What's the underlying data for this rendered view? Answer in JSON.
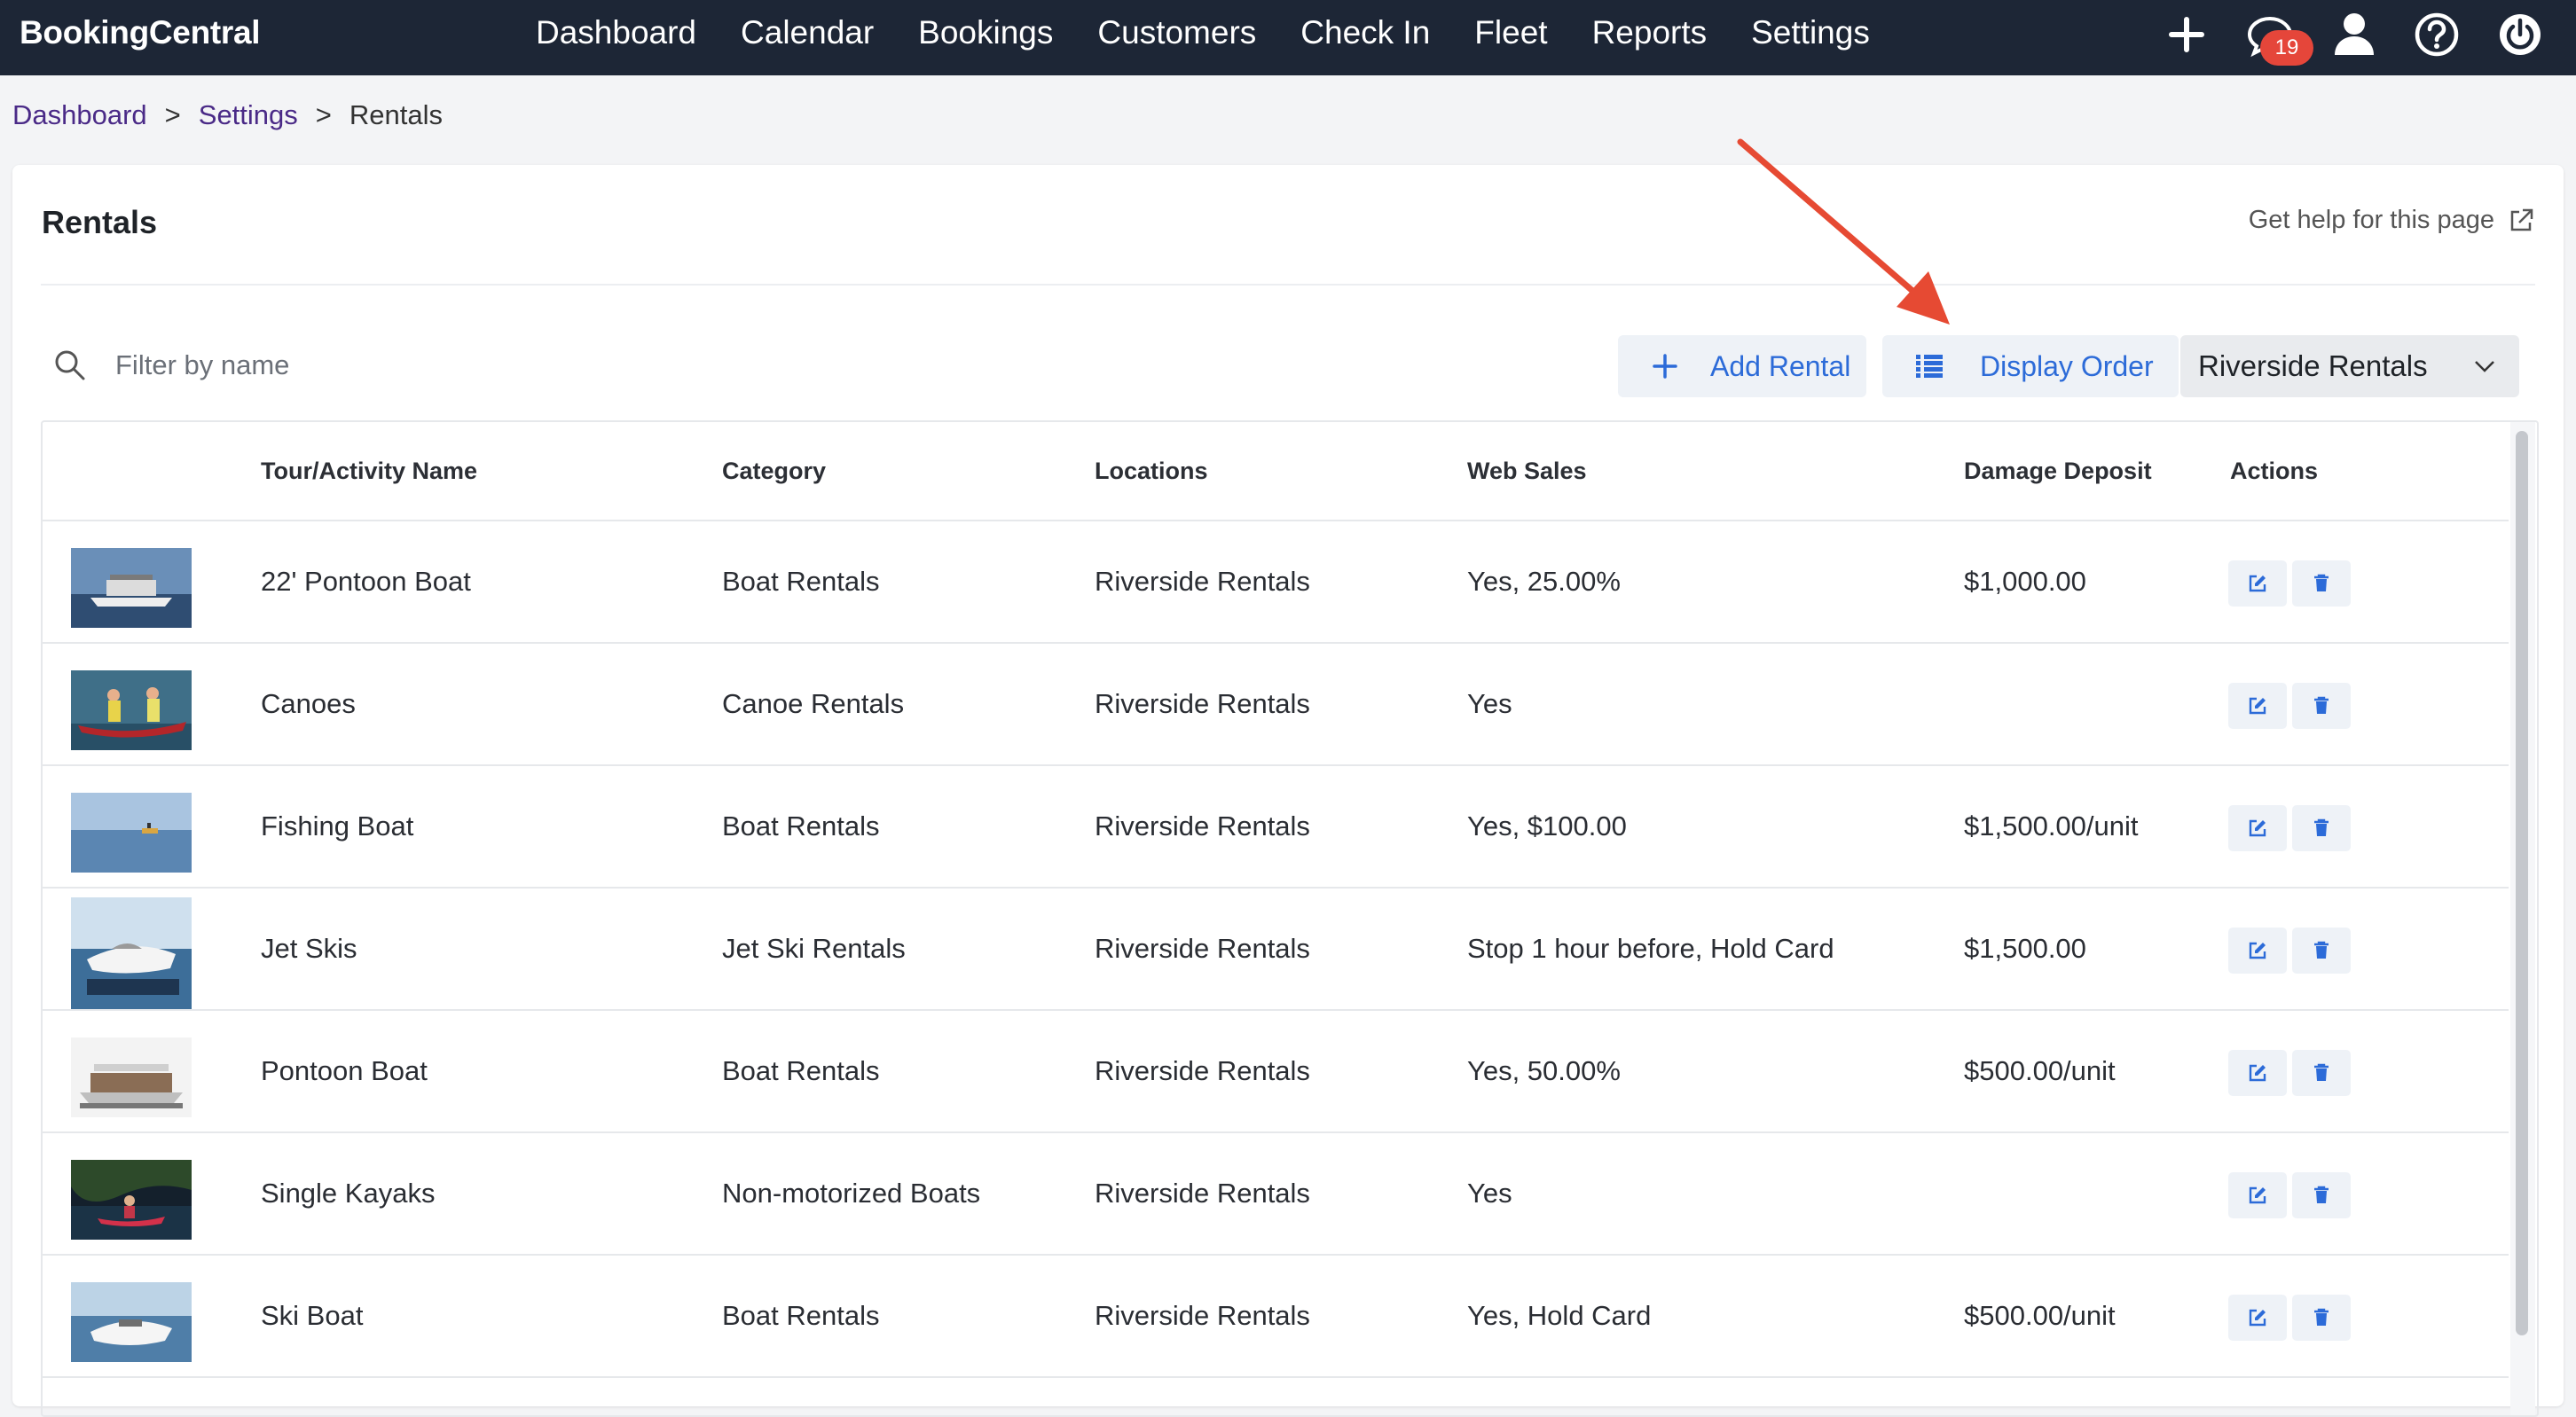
{
  "colors": {
    "nav_bg": "#1d2636",
    "accent": "#2c6bd8",
    "breadcrumb_link": "#4a2a87",
    "badge": "#e5463a",
    "annotation_arrow": "#e64a33"
  },
  "app": {
    "brand": "BookingCentral"
  },
  "nav": {
    "links": [
      "Dashboard",
      "Calendar",
      "Bookings",
      "Customers",
      "Check In",
      "Fleet",
      "Reports",
      "Settings"
    ],
    "icons": [
      "plus-icon",
      "chat-icon",
      "user-icon",
      "help-icon",
      "power-icon"
    ],
    "notification_count": "19"
  },
  "breadcrumb": {
    "items": [
      "Dashboard",
      "Settings",
      "Rentals"
    ],
    "separator": ">"
  },
  "page": {
    "title": "Rentals",
    "help_link": "Get help for this page"
  },
  "toolbar": {
    "filter_placeholder": "Filter by name",
    "add_label": "Add Rental",
    "order_label": "Display Order",
    "location_select": "Riverside Rentals"
  },
  "table": {
    "headers": [
      "Tour/Activity Name",
      "Category",
      "Locations",
      "Web Sales",
      "Damage Deposit",
      "Actions"
    ],
    "rows": [
      {
        "thumb": "pontoon-boat-photo",
        "name": "22' Pontoon Boat",
        "category": "Boat Rentals",
        "location": "Riverside Rentals",
        "web_sales": "Yes, 25.00%",
        "deposit": "$1,000.00"
      },
      {
        "thumb": "canoe-photo",
        "name": "Canoes",
        "category": "Canoe Rentals",
        "location": "Riverside Rentals",
        "web_sales": "Yes",
        "deposit": ""
      },
      {
        "thumb": "fishing-boat-photo",
        "name": "Fishing Boat",
        "category": "Boat Rentals",
        "location": "Riverside Rentals",
        "web_sales": "Yes, $100.00",
        "deposit": "$1,500.00/unit"
      },
      {
        "thumb": "jet-ski-photo",
        "name": "Jet Skis",
        "category": "Jet Ski Rentals",
        "location": "Riverside Rentals",
        "web_sales": "Stop 1 hour before, Hold Card",
        "deposit": "$1,500.00"
      },
      {
        "thumb": "pontoon-boat-photo",
        "name": "Pontoon Boat",
        "category": "Boat Rentals",
        "location": "Riverside Rentals",
        "web_sales": "Yes, 50.00%",
        "deposit": "$500.00/unit"
      },
      {
        "thumb": "kayak-photo",
        "name": "Single Kayaks",
        "category": "Non-motorized Boats",
        "location": "Riverside Rentals",
        "web_sales": "Yes",
        "deposit": ""
      },
      {
        "thumb": "ski-boat-photo",
        "name": "Ski Boat",
        "category": "Boat Rentals",
        "location": "Riverside Rentals",
        "web_sales": "Yes, Hold Card",
        "deposit": "$500.00/unit"
      }
    ]
  }
}
